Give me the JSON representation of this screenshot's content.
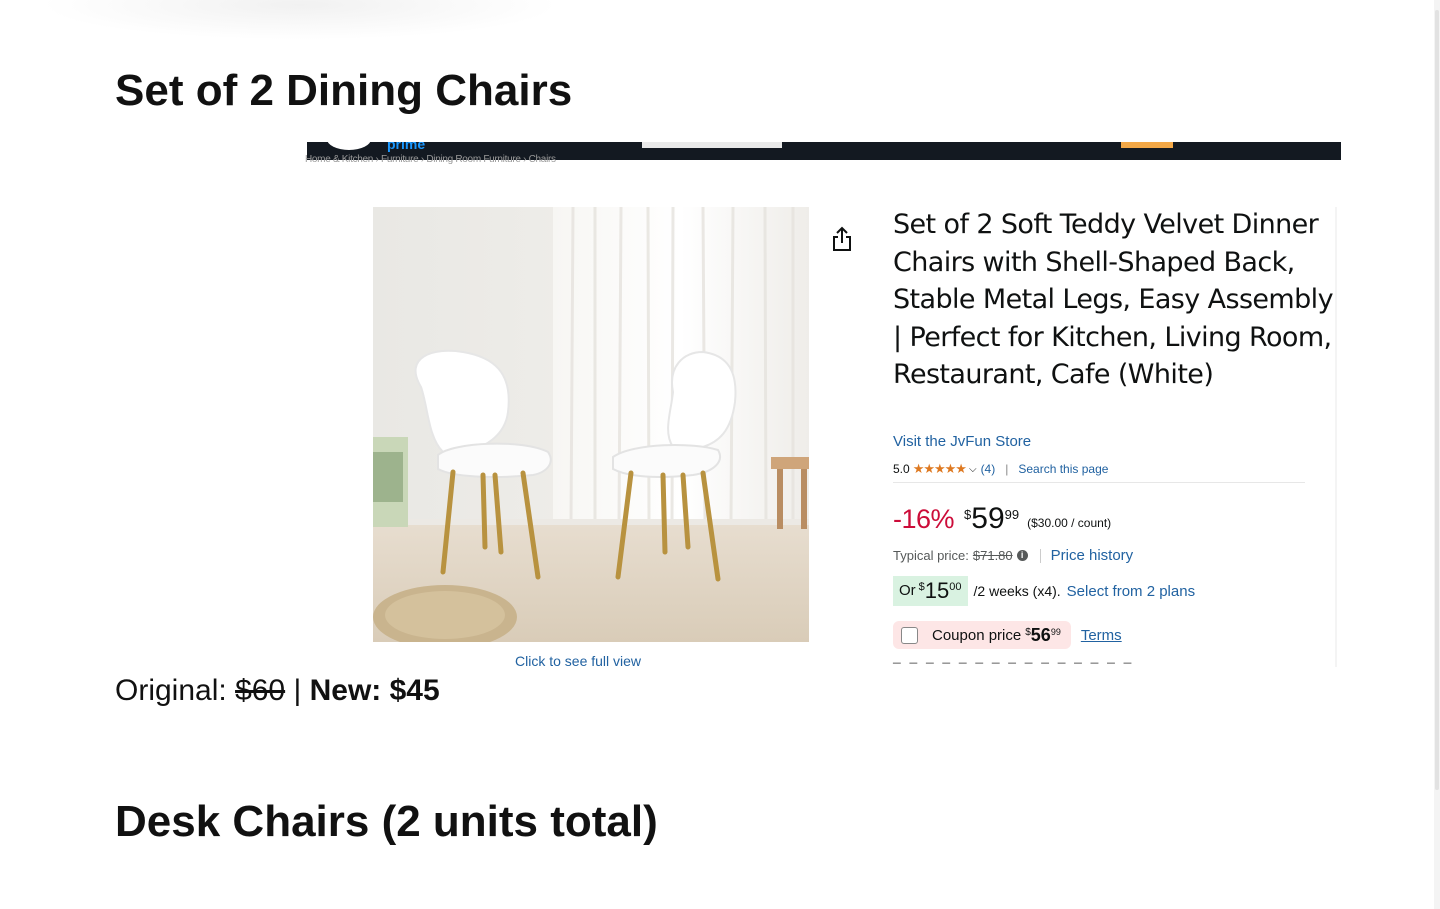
{
  "section1": {
    "title": "Set of 2 Dining Chairs"
  },
  "section2": {
    "title": "Desk Chairs (2 units total)"
  },
  "note": {
    "original_label": "Original:",
    "original_price": "$60",
    "separator": "|",
    "new_label": "New: $45"
  },
  "product": {
    "header_text": "prime",
    "breadcrumb": "Home & Kitchen › Furniture › Dining Room Furniture › Chairs",
    "title": "Set of 2 Soft Teddy Velvet Dinner Chairs with Shell-Shaped Back, Stable Metal Legs, Easy Assembly | Perfect for Kitchen, Living Room, Restaurant, Cafe (White)",
    "store_link": "Visit the JvFun Store",
    "rating": "5.0",
    "stars": "★★★★★",
    "rating_count": "(4)",
    "rating_sep": "|",
    "search_page": "Search this page",
    "discount": "-16%",
    "price_currency": "$",
    "price_whole": "59",
    "price_fraction": "99",
    "unit_price": "($30.00 / count)",
    "typical_label": "Typical price:",
    "typical_price": "$71.80",
    "price_history": "Price history",
    "plan_or": "Or",
    "plan_currency": "$",
    "plan_whole": "15",
    "plan_fraction": "00",
    "plan_text": "/2 weeks (x4).",
    "plan_link": "Select from 2 plans",
    "coupon_label": "Coupon price",
    "coupon_currency": "$",
    "coupon_whole": "56",
    "coupon_fraction": "99",
    "terms": "Terms",
    "click_full_view": "Click to see full view"
  },
  "icons": {
    "share": "share-icon",
    "info": "info-icon",
    "chevron": "chevron-down-icon",
    "checkbox": "checkbox"
  },
  "colors": {
    "link": "#2162a1",
    "discount": "#cc0c39",
    "stars": "#de7921",
    "header": "#131921",
    "plan_badge": "#d9f2e1",
    "coupon_bg": "#fde6e6"
  }
}
